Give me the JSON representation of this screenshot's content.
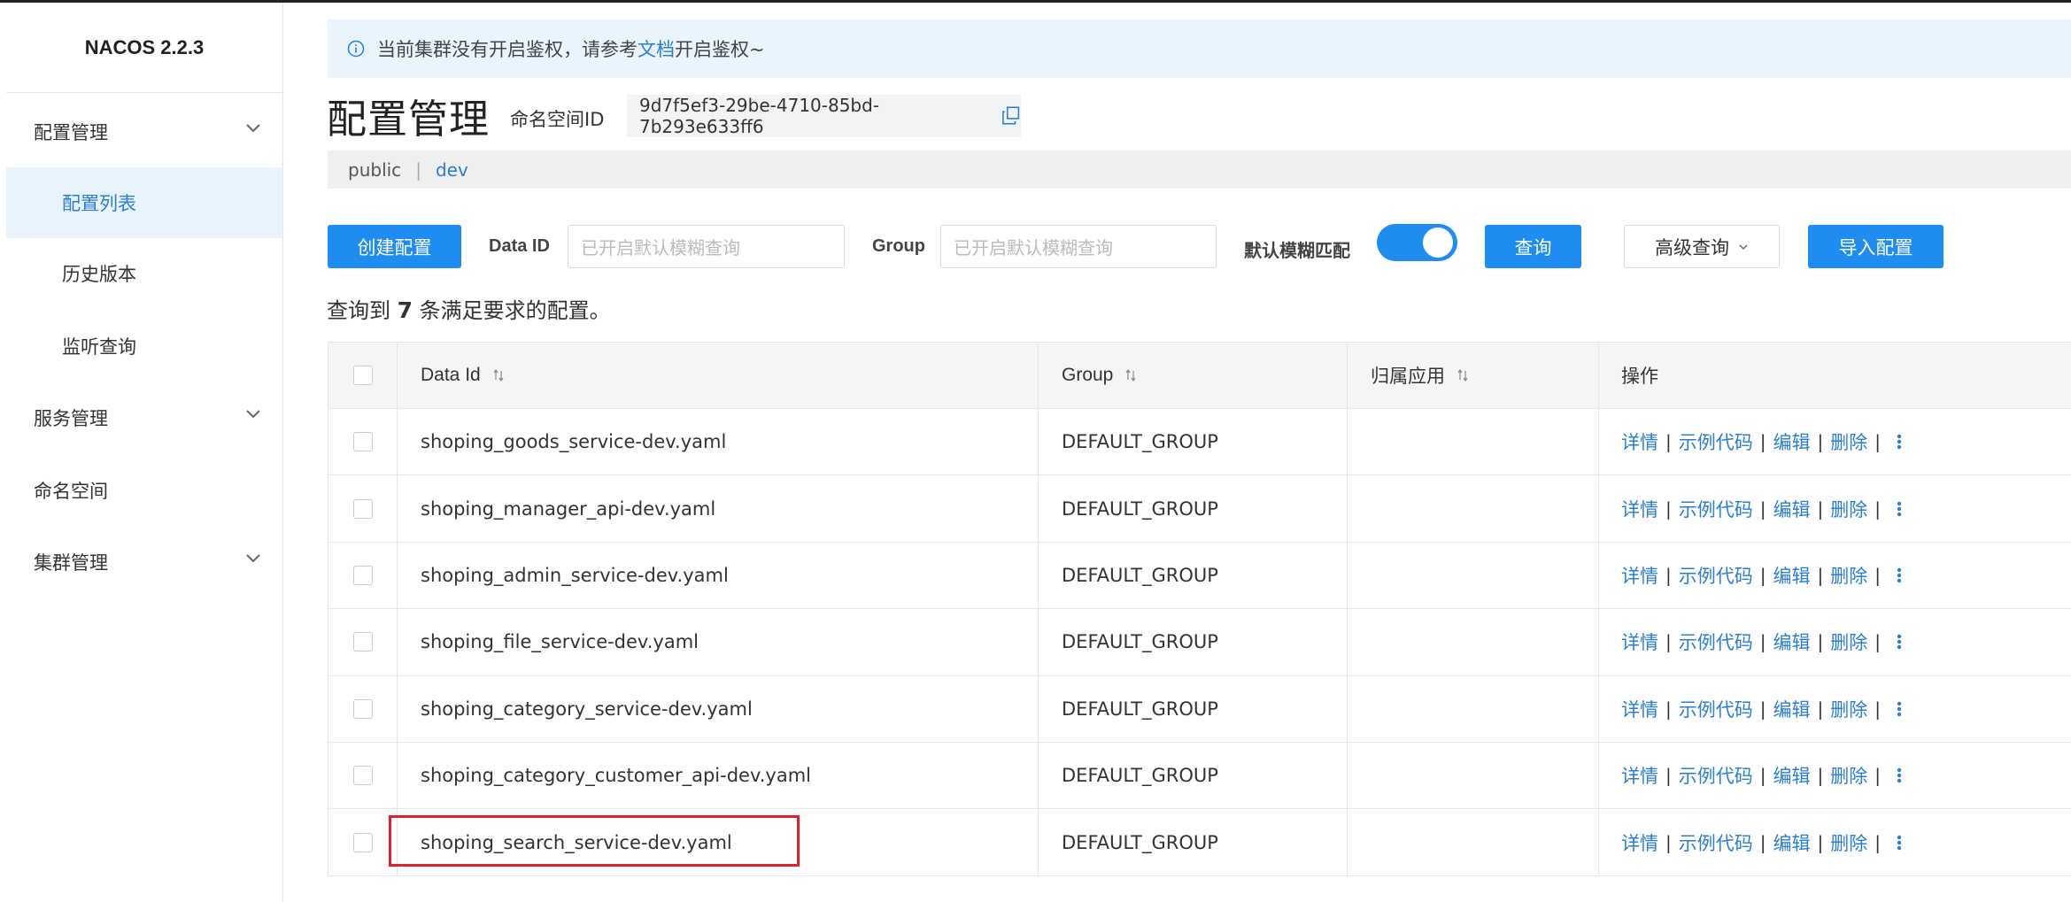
{
  "app": {
    "title": "NACOS 2.2.3"
  },
  "sidebar": {
    "items": [
      {
        "label": "配置管理",
        "expandable": true
      },
      {
        "label": "配置列表",
        "active": true
      },
      {
        "label": "历史版本"
      },
      {
        "label": "监听查询"
      },
      {
        "label": "服务管理",
        "expandable": true
      },
      {
        "label": "命名空间"
      },
      {
        "label": "集群管理",
        "expandable": true
      }
    ]
  },
  "notice": {
    "prefix": "当前集群没有开启鉴权，请参考",
    "link": "文档",
    "suffix": "开启鉴权~"
  },
  "page": {
    "title": "配置管理",
    "namespace_label": "命名空间ID",
    "namespace_id": "9d7f5ef3-29be-4710-85bd-7b293e633ff6"
  },
  "namespaces": {
    "items": [
      "public",
      "dev"
    ],
    "separator": "|",
    "active": "dev"
  },
  "toolbar": {
    "create_label": "创建配置",
    "dataid_label": "Data ID",
    "dataid_placeholder": "已开启默认模糊查询",
    "group_label": "Group",
    "group_placeholder": "已开启默认模糊查询",
    "fuzzy_label": "默认模糊匹配",
    "fuzzy_on": true,
    "query_label": "查询",
    "advanced_label": "高级查询",
    "import_label": "导入配置"
  },
  "result": {
    "prefix": "查询到 ",
    "count": "7",
    "suffix": " 条满足要求的配置。"
  },
  "table": {
    "columns": [
      "Data Id",
      "Group",
      "归属应用",
      "操作"
    ],
    "rows": [
      {
        "data_id": "shoping_goods_service-dev.yaml",
        "group": "DEFAULT_GROUP",
        "app": ""
      },
      {
        "data_id": "shoping_manager_api-dev.yaml",
        "group": "DEFAULT_GROUP",
        "app": ""
      },
      {
        "data_id": "shoping_admin_service-dev.yaml",
        "group": "DEFAULT_GROUP",
        "app": ""
      },
      {
        "data_id": "shoping_file_service-dev.yaml",
        "group": "DEFAULT_GROUP",
        "app": ""
      },
      {
        "data_id": "shoping_category_service-dev.yaml",
        "group": "DEFAULT_GROUP",
        "app": ""
      },
      {
        "data_id": "shoping_category_customer_api-dev.yaml",
        "group": "DEFAULT_GROUP",
        "app": ""
      },
      {
        "data_id": "shoping_search_service-dev.yaml",
        "group": "DEFAULT_GROUP",
        "app": ""
      }
    ],
    "actions": [
      "详情",
      "示例代码",
      "编辑",
      "删除"
    ],
    "action_separator": "|",
    "highlighted_row": 6
  },
  "colors": {
    "accent": "#1e8cf0",
    "link": "#2a7ed3",
    "highlight": "#e0202a",
    "notice_bg": "#e9f4fc",
    "active_bg": "#e8f3fc"
  },
  "icons": {
    "info": "info-icon",
    "copy": "copy-icon",
    "chevron": "chevron-down-icon",
    "sort": "sort-icon",
    "more": "more-vertical-icon"
  }
}
